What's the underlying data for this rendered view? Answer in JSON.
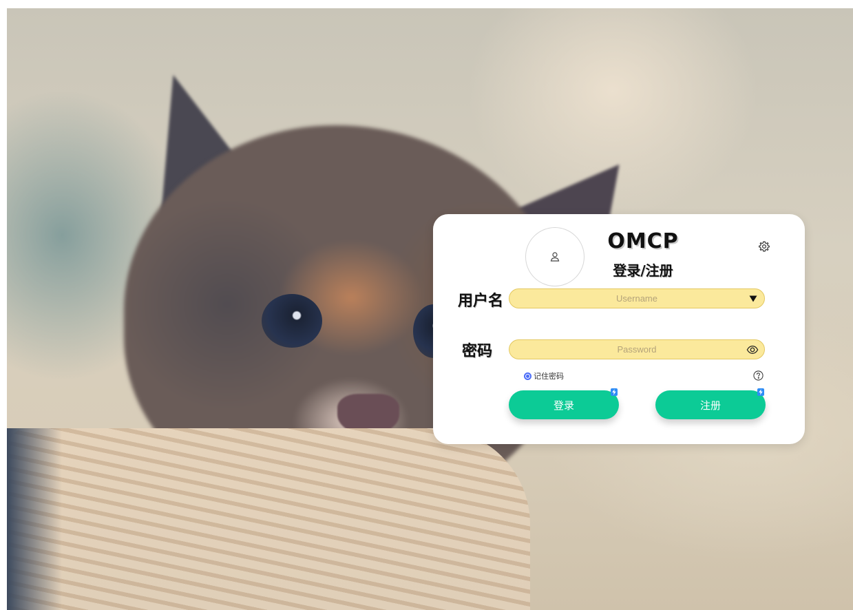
{
  "login": {
    "title": "OMCP",
    "subtitle": "登录/注册",
    "username_label": "用户名",
    "username_placeholder": "Username",
    "password_label": "密码",
    "password_placeholder": "Password",
    "remember_label": "记住密码",
    "remember_checked": true,
    "login_button": "登录",
    "register_button": "注册"
  },
  "icons": {
    "avatar": "user-icon",
    "settings": "gear-icon",
    "username_dropdown": "triangle-down-icon",
    "password_toggle": "eye-icon",
    "help": "question-circle-icon",
    "button_badge": "bolt-icon"
  },
  "colors": {
    "input_background": "#fbe99c",
    "button_background": "#0ccb96",
    "radio_accent": "#4a6cf7",
    "badge": "#2f8df5"
  }
}
